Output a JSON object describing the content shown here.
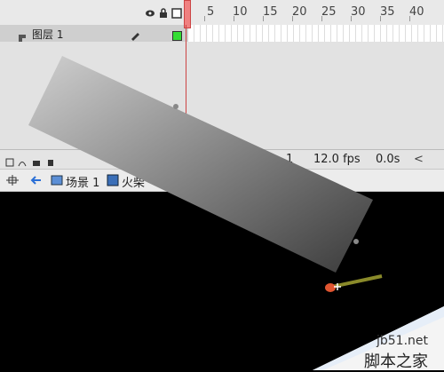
{
  "timeline": {
    "ruler_numbers": [
      "5",
      "10",
      "15",
      "20",
      "25",
      "30",
      "35",
      "40"
    ],
    "layer_name": "图层 1"
  },
  "status": {
    "frame": "1",
    "fps": "12.0 fps",
    "time": "0.0s"
  },
  "editbar": {
    "scene": "场景 1",
    "symbol": "火柴"
  },
  "watermark": {
    "site": "jb51.net",
    "name": "脚本之家"
  }
}
